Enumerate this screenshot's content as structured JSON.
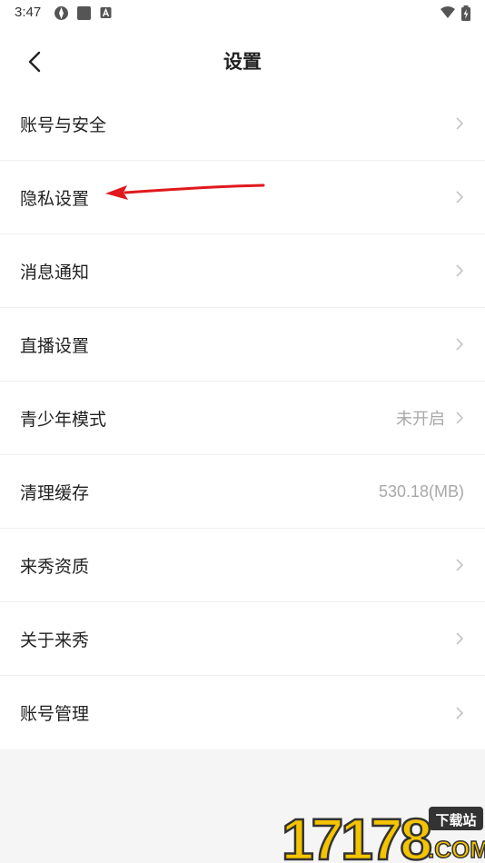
{
  "status_bar": {
    "time": "3:47"
  },
  "header": {
    "title": "设置",
    "back_icon": "chevron-left-icon"
  },
  "menu": [
    {
      "label": "账号与安全",
      "value": "",
      "chevron": true
    },
    {
      "label": "隐私设置",
      "value": "",
      "chevron": true
    },
    {
      "label": "消息通知",
      "value": "",
      "chevron": true
    },
    {
      "label": "直播设置",
      "value": "",
      "chevron": true
    },
    {
      "label": "青少年模式",
      "value": "未开启",
      "chevron": true
    },
    {
      "label": "清理缓存",
      "value": "530.18(MB)",
      "chevron": false
    },
    {
      "label": "来秀资质",
      "value": "",
      "chevron": true
    },
    {
      "label": "关于来秀",
      "value": "",
      "chevron": true
    },
    {
      "label": "账号管理",
      "value": "",
      "chevron": true
    }
  ],
  "watermark": {
    "logo_text": "17178",
    "tag": "下载站",
    "domain": ".COM"
  },
  "colors": {
    "annotation_arrow": "#e0191e",
    "watermark_yellow": "#f5c400",
    "page_background": "#f5f5f5"
  }
}
